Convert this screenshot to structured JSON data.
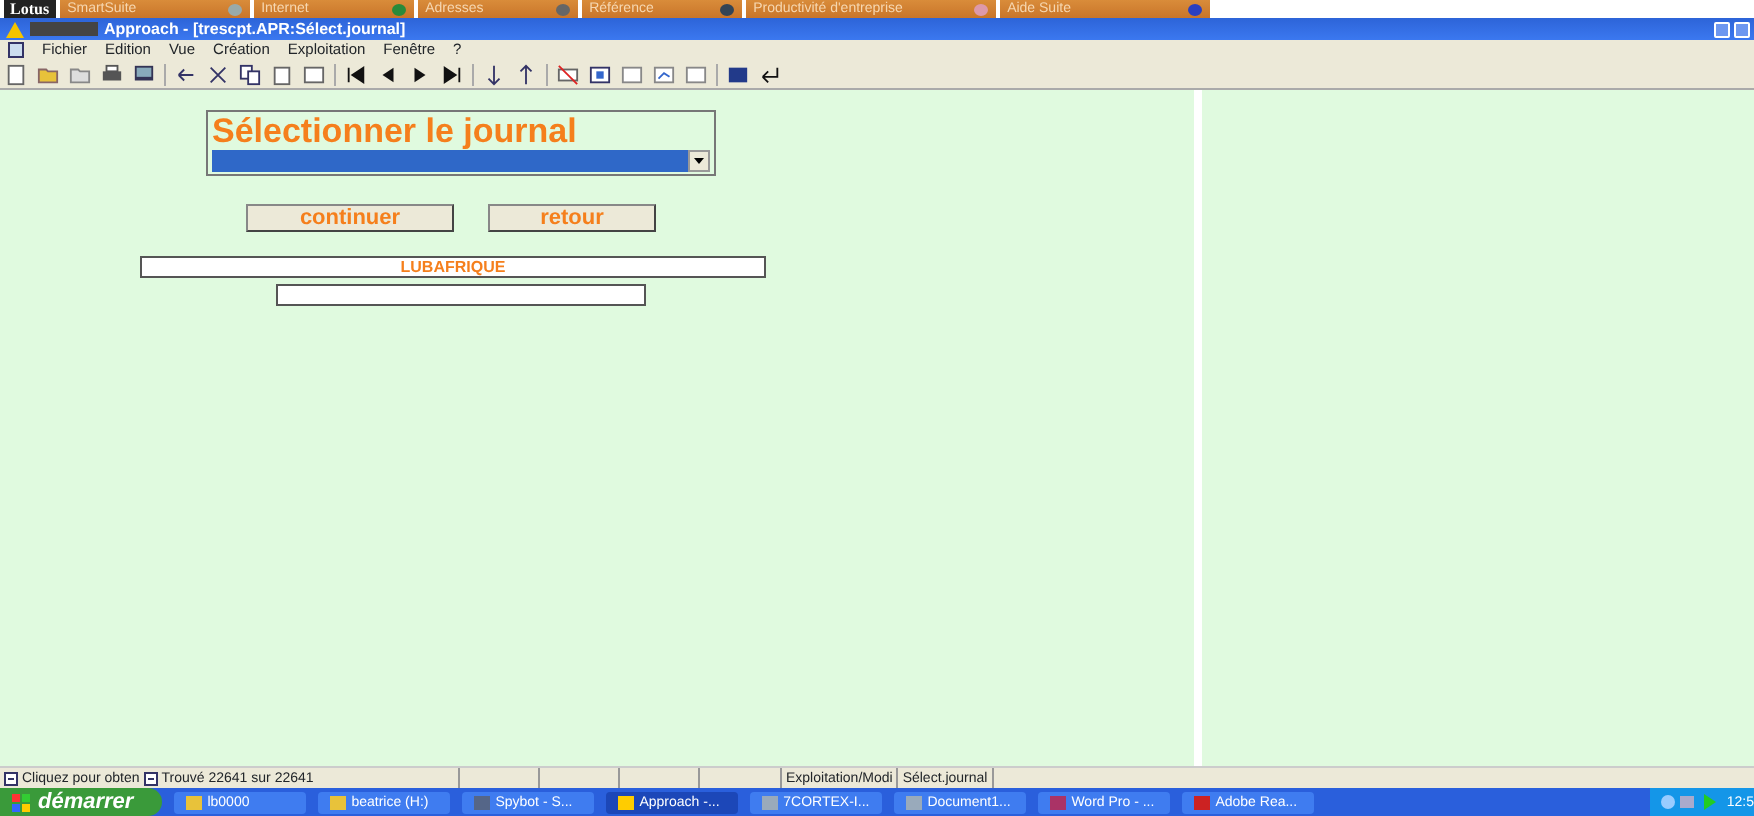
{
  "suite_bar": {
    "logo": "Lotus",
    "items": [
      {
        "label": "SmartSuite"
      },
      {
        "label": "Internet"
      },
      {
        "label": "Adresses"
      },
      {
        "label": "Référence"
      },
      {
        "label": "Productivité d'entreprise"
      },
      {
        "label": "Aide Suite"
      }
    ]
  },
  "window": {
    "title": "Approach - [trescpt.APR:Sélect.journal]"
  },
  "menu": [
    "Fichier",
    "Edition",
    "Vue",
    "Création",
    "Exploitation",
    "Fenêtre",
    "?"
  ],
  "form": {
    "heading": "Sélectionner le journal",
    "dropdown": {
      "selected": true
    },
    "buttons": [
      "continuer",
      "retour"
    ],
    "fields": [
      {
        "kind": "text",
        "value": "LUBAFRIQUE"
      },
      {
        "kind": "text"
      }
    ]
  },
  "status_bar": [
    "Cliquez pour obten",
    "Trouvé 22641 sur 22641",
    "Exploitation/Modi",
    "Sélect.journal"
  ],
  "taskbar": {
    "start": "démarrer",
    "tasks": [
      {
        "label": "lb0000",
        "selected": false
      },
      {
        "label": "beatrice (H:)",
        "selected": false
      },
      {
        "label": "Spybot - S...",
        "selected": false
      },
      {
        "label": "Approach -...",
        "selected": true
      },
      {
        "label": "7CORTEX-I...",
        "selected": false
      },
      {
        "label": "Document1...",
        "selected": false
      },
      {
        "label": "Word Pro - ...",
        "selected": false
      },
      {
        "label": "Adobe Rea...",
        "selected": false
      }
    ],
    "clock": "12:5"
  }
}
